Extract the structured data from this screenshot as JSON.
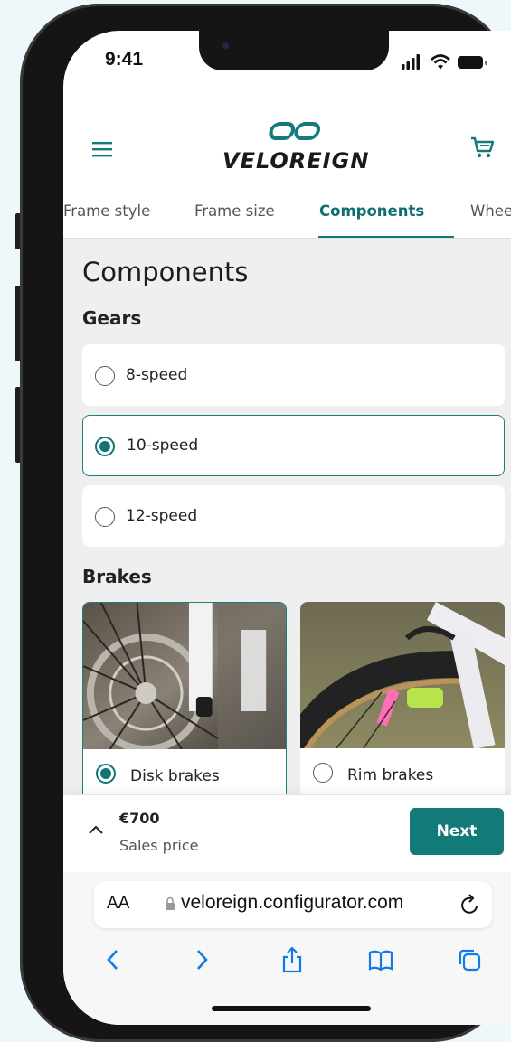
{
  "status_bar": {
    "time": "9:41"
  },
  "header": {
    "brand": "VELOREIGN",
    "brand_color": "#1a1a1a",
    "accent": "#127a78"
  },
  "tabs": [
    {
      "label": "Frame style",
      "active": false
    },
    {
      "label": "Frame size",
      "active": false
    },
    {
      "label": "Components",
      "active": true
    },
    {
      "label": "Whee",
      "active": false
    }
  ],
  "main": {
    "title": "Components",
    "gears": {
      "label": "Gears",
      "options": [
        {
          "label": "8-speed",
          "selected": false
        },
        {
          "label": "10-speed",
          "selected": true
        },
        {
          "label": "12-speed",
          "selected": false
        }
      ]
    },
    "brakes": {
      "label": "Brakes",
      "options": [
        {
          "label": "Disk brakes",
          "selected": true
        },
        {
          "label": "Rim brakes",
          "selected": false
        }
      ]
    }
  },
  "summary": {
    "price": "€700",
    "price_label": "Sales price",
    "next_label": "Next"
  },
  "browser": {
    "aa_label": "AA",
    "url": "veloreign.configurator.com"
  }
}
